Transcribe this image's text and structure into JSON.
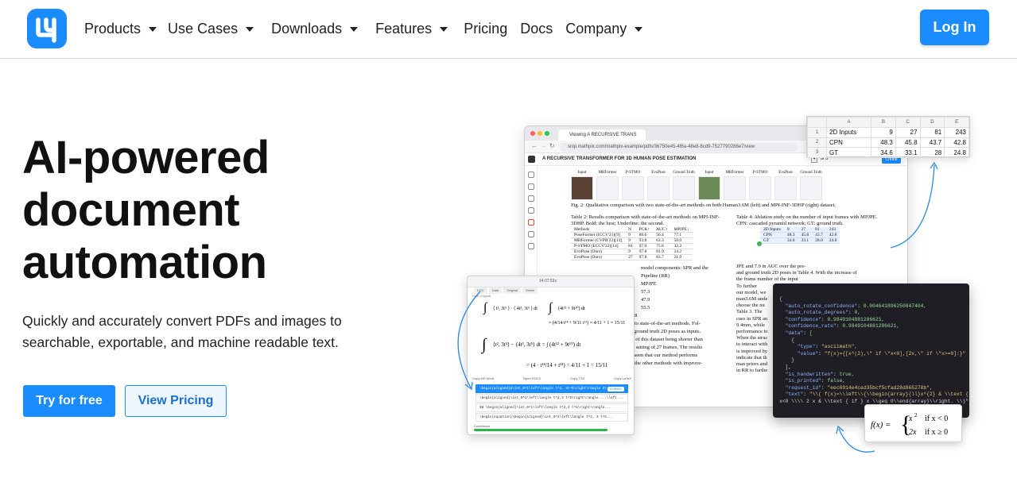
{
  "nav": {
    "items": [
      {
        "label": "Products",
        "dropdown": true
      },
      {
        "label": "Use Cases",
        "dropdown": true
      },
      {
        "label": "Downloads",
        "dropdown": true
      },
      {
        "label": "Features",
        "dropdown": true
      },
      {
        "label": "Pricing",
        "dropdown": false
      },
      {
        "label": "Docs",
        "dropdown": false
      },
      {
        "label": "Company",
        "dropdown": true
      }
    ],
    "login_label": "Log In"
  },
  "hero": {
    "title_lines": [
      "AI-powered",
      "document",
      "automation"
    ],
    "subtitle_lines": [
      "Quickly and accurately convert PDFs and images to",
      "searchable, exportable, and machine readable text."
    ],
    "try_label": "Try for free",
    "pricing_label": "View Pricing"
  },
  "browser": {
    "tab_title": "Viewing A RECURSIVE TRANS",
    "url": "snip.mathpix.com/mathpix-example/pdfs/36750e45-4f6a-48e8-8cd9-7527790286e7/view",
    "doc_title": "A RECURSIVE TRANSFORMER FOR 3D HUMAN POSE ESTIMATION",
    "page_current": "4",
    "page_total": "of 5",
    "create_label": "Create",
    "fig_heads": [
      "Input",
      "MHFormer",
      "P-STMO",
      "EvoPose",
      "Ground Truth",
      "Input",
      "MHFormer",
      "P-STMO",
      "EvoPose",
      "Ground Truth"
    ],
    "fig_caption": "Fig. 2: Qualitative comparison with two state-of-the-art methods on both Human3.6M (left) and MPI-INF-3DHP (right) dataset.",
    "table2_caption": "Table 2: Results comparison with state-of-the-art methods on MPI-INF-3DHP. Bold: the best; Underline: the second.",
    "table2_rows": [
      [
        "Methods",
        "N",
        "PCK↑",
        "AUC↑",
        "MPJPE↓"
      ],
      [
        "PoseFormer (ICCV'21)[9]",
        "9",
        "88.6",
        "56.4",
        "77.1"
      ],
      [
        "MHFormer (CVPR'22)[13]",
        "9",
        "93.8",
        "63.3",
        "58.0"
      ],
      [
        "P-STMO (ECCV'22)[14]",
        "81",
        "97.9",
        "75.8",
        "32.2"
      ],
      [
        "EvoPose (Ours)",
        "9",
        "97.8",
        "81.9",
        "24.2"
      ],
      [
        "EvoPose (Ours)",
        "27",
        "97.8",
        "83.7",
        "21.9"
      ]
    ],
    "table4_caption": "Table 4: Ablation study on the number of input frames with MPJPE. CPN: cascaded pyramid network; GT: ground truth.",
    "table4_rows": [
      [
        "2D Inputs",
        "9",
        "27",
        "81",
        "243"
      ],
      [
        "CPN",
        "48.3",
        "45.8",
        "43.7",
        "42.8"
      ],
      [
        "GT",
        "34.6",
        "33.1",
        "28.0",
        "24.8"
      ]
    ],
    "body_fragments": [
      "model components: SPR and the",
      "Pipeline (RR)",
      "MPJPE",
      "57.3",
      "47.9",
      "55.5",
      "45.8",
      "ed to state-of-the-art methods. Fol-",
      "se ground truth 2D poses as inputs.",
      "ths of this dataset being shorter than",
      "the setting of 27 frames. The results",
      "be seen that our method performs",
      "all the other methods with improve-",
      "JPE and 7.9 in AUC over the pre-",
      "and ground truth 2D poses in Table 4. With the increase of",
      "the frame number of the input",
      "To further",
      "our model, we",
      "man3.6M unde",
      "choose the nu",
      "Table 3. The",
      "cues in SPR an",
      "9.4mm, while",
      "performance to",
      "When the struc",
      "to interact with",
      "is improved by",
      "indicate that th",
      "man priors and",
      "in RR to furthe"
    ]
  },
  "spreadsheet": {
    "col_headers": [
      "",
      "A",
      "B",
      "C",
      "D",
      "E"
    ],
    "rows": [
      [
        "1",
        "2D Inputs",
        "9",
        "27",
        "81",
        "243"
      ],
      [
        "2",
        "CPN",
        "48.3",
        "45.8",
        "43.7",
        "42.8"
      ],
      [
        "3",
        "GT",
        "34.6",
        "33.1",
        "28",
        "24.8"
      ]
    ]
  },
  "snip_app": {
    "title": "14:07:53s",
    "tabs": [
      "DOC",
      "Data",
      "Original",
      "Solver"
    ],
    "hide_original": "Hide Original",
    "copy_ms_word": "Copy MS Word",
    "open_docx": "Open DOCX",
    "copy_tsv": "Copy TSV",
    "copy_latex": "Copy LaTeX",
    "rows": [
      "\\begin{aligned}&\\int_0^1\\left\\langle t^2, 3t^5\\right\\rangle dt ...",
      "\\begin{aligned}\\int_0^1\\left\\langle t^2,3 t^5\\right\\rangle ...\\left...",
      "$$ \\begin{aligned}\\int_0^1\\left\\langle t^2,3 t^5\\right\\rangle...",
      "\\begin{equation}\\begin{aligned}\\int_0^1\\left\\langle t^2, 3 t^5..."
    ],
    "copied_label": "COPIED",
    "confidence_label": "Confidence"
  },
  "json_panel": {
    "lines": [
      "{",
      "  \"auto_rotate_confidence\": 0.004641896250847404,",
      "  \"auto_rotate_degrees\": 0,",
      "  \"confidence\": 0.9849104881286621,",
      "  \"confidence_rate\": 0.9849104881286621,",
      "  \"data\": [",
      "    {",
      "      \"type\": \"asciimath\",",
      "      \"value\": \"f(x)={[x^(2),\\\" if \\\"x<0],[2x,\\\" if \\\"x>=0]:}\"",
      "    }",
      "  ],",
      "  \"is_handwritten\": true,",
      "  \"is_printed\": false,",
      "  \"request_id\": \"eec6914e4cad35bcf5cfad28d865278b\",",
      "  \"text\": \"\\\\( f(x)=\\\\left\\\\{\\\\begin{array}{ll}x^{2} & \\\\text { if }",
      "x<0 \\\\\\\\ 2 x & \\\\text { if } x \\\\geq 0\\\\end{array}\\\\right. \\\\)\""
    ]
  },
  "formula": {
    "lhs": "f(x) =",
    "case1_expr": "x",
    "case1_exp": "2",
    "case1_cond": "if x < 0",
    "case2_expr": "2x",
    "case2_cond": "if x ≥ 0"
  },
  "colors": {
    "brand_blue": "#1a8cff",
    "json_bg": "#1e1e24",
    "confidence_green": "#28b34b"
  }
}
